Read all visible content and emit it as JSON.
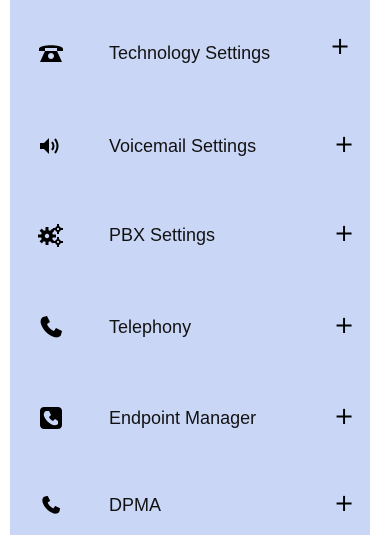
{
  "menu": {
    "items": [
      {
        "label": "Technology Settings",
        "icon": "classic-phone-icon",
        "expand": "+"
      },
      {
        "label": "Voicemail Settings",
        "icon": "volume-icon",
        "expand": "+"
      },
      {
        "label": "PBX Settings",
        "icon": "gears-icon",
        "expand": "+"
      },
      {
        "label": "Telephony",
        "icon": "phone-handset-icon",
        "expand": "+"
      },
      {
        "label": "Endpoint Manager",
        "icon": "phone-square-icon",
        "expand": "+"
      },
      {
        "label": "DPMA",
        "icon": "phone-handset-icon",
        "expand": "+"
      }
    ]
  },
  "colors": {
    "panel_background": "#c9d6f5",
    "text": "#111111",
    "icon": "#000000"
  }
}
